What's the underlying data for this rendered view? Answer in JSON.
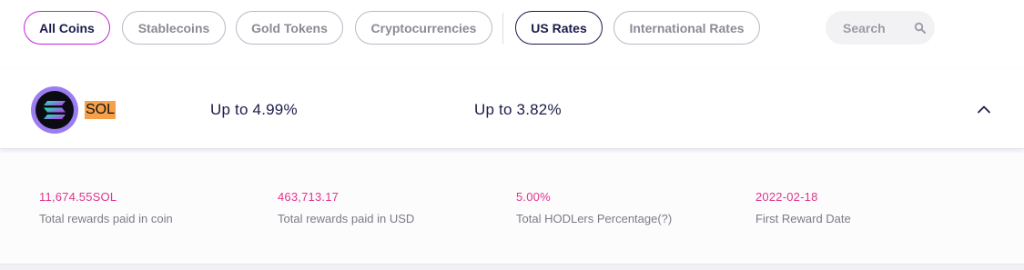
{
  "filters": {
    "all_coins": "All Coins",
    "stablecoins": "Stablecoins",
    "gold_tokens": "Gold Tokens",
    "cryptocurrencies": "Cryptocurrencies",
    "us_rates": "US Rates",
    "international_rates": "International Rates",
    "search_label": "Search"
  },
  "coin": {
    "symbol": "SOL",
    "rate_1": "Up to 4.99%",
    "rate_2": "Up to 3.82%"
  },
  "stats": [
    {
      "value": "11,674.55SOL",
      "label": "Total rewards paid in coin"
    },
    {
      "value": "463,713.17",
      "label": "Total rewards paid in USD"
    },
    {
      "value": "5.00%",
      "label": "Total HODLers Percentage(?)"
    },
    {
      "value": "2022-02-18",
      "label": "First Reward Date"
    }
  ],
  "colors": {
    "accent_magenta": "#c026d3",
    "navy": "#1b1b4b",
    "stat_value": "#e0348d",
    "sol_highlight": "#f7a04b"
  },
  "icons": {
    "search": "search-icon",
    "collapse": "chevron-up-icon",
    "coin": "solana-logo-icon"
  }
}
